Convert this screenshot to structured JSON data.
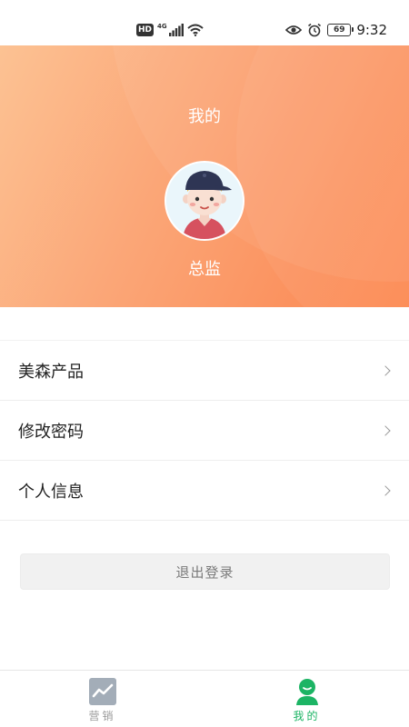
{
  "status_bar": {
    "hd_badge": "HD",
    "network_type": "4G",
    "battery_level": "69",
    "time": "9:32",
    "icons": [
      "hd-icon",
      "signal-icon",
      "wifi-icon",
      "eye-icon",
      "alarm-icon",
      "battery-icon"
    ]
  },
  "header": {
    "title": "我的",
    "avatar_icon": "user-avatar",
    "user_name": "总监",
    "gradient_colors": [
      "#fcc293",
      "#fb9360",
      "#fc8a52"
    ]
  },
  "menu": {
    "items": [
      {
        "label": "美森产品",
        "icon": "chevron-right-icon"
      },
      {
        "label": "修改密码",
        "icon": "chevron-right-icon"
      },
      {
        "label": "个人信息",
        "icon": "chevron-right-icon"
      }
    ]
  },
  "logout": {
    "label": "退出登录"
  },
  "tab_bar": {
    "active_color": "#1cb464",
    "inactive_color": "#9a9a9a",
    "tabs": [
      {
        "label": "营销",
        "icon": "chart-trend-icon",
        "active": false
      },
      {
        "label": "我的",
        "icon": "person-icon",
        "active": true
      }
    ]
  }
}
